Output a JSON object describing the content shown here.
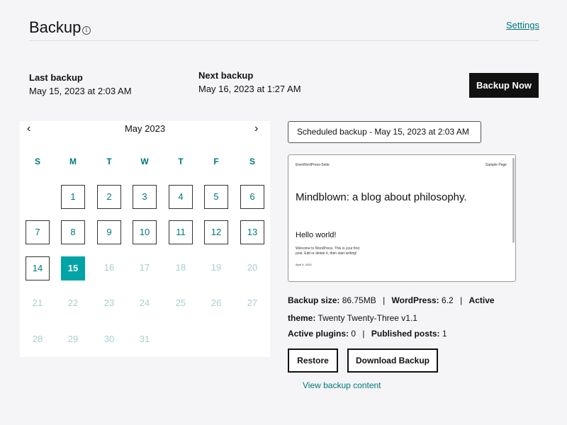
{
  "header": {
    "title": "Backup",
    "info_icon": "i",
    "settings_label": "Settings"
  },
  "last_backup": {
    "label": "Last backup",
    "value": "May 15, 2023 at 2:03 AM"
  },
  "next_backup": {
    "label": "Next backup",
    "value": "May 16, 2023 at 1:27 AM"
  },
  "backup_now_label": "Backup Now",
  "calendar": {
    "month": "May 2023",
    "prev_icon": "‹",
    "next_icon": "›",
    "weekdays": [
      "S",
      "M",
      "T",
      "W",
      "T",
      "F",
      "S"
    ],
    "start_weekday": 1,
    "days_in_month": 31,
    "available_days": [
      1,
      2,
      3,
      4,
      5,
      6,
      7,
      8,
      9,
      10,
      11,
      12,
      13,
      14
    ],
    "selected_day": 15
  },
  "scheduled_select": "Scheduled backup - May 15, 2023 at 2:03 AM",
  "preview": {
    "site_name": "EineWordPress-Seite",
    "sample_page": "Sample Page",
    "headline": "Mindblown: a blog about philosophy.",
    "post_title": "Hello world!",
    "excerpt_line1": "Welcome to WordPress. This is your first",
    "excerpt_line2": "post. Edit or delete it, then start writing!",
    "post_date": "April 9, 2023"
  },
  "meta": {
    "backup_size_label": "Backup size:",
    "backup_size_value": "86.75MB",
    "wordpress_label": "WordPress:",
    "wordpress_value": "6.2",
    "theme_label_1": "Active",
    "theme_label_2": "theme:",
    "theme_value": "Twenty Twenty-Three v1.1",
    "plugins_label": "Active plugins:",
    "plugins_value": "0",
    "posts_label": "Published posts:",
    "posts_value": "1",
    "separator": "|"
  },
  "actions": {
    "restore_label": "Restore",
    "download_label": "Download Backup",
    "view_content_label": "View backup content"
  },
  "colors": {
    "accent": "#00787a",
    "selected_day": "#00a4a6",
    "disabled_day": "#a8cfd0"
  }
}
